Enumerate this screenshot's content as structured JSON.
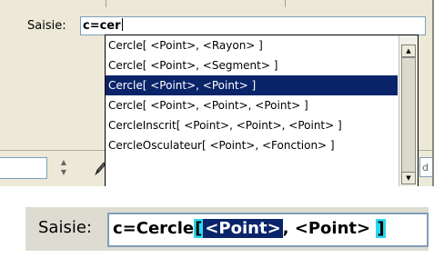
{
  "input": {
    "label": "Saisie:",
    "value": "c=cer"
  },
  "suggestions": {
    "items": [
      "Cercle[ <Point>, <Rayon> ]",
      "Cercle[ <Point>, <Segment> ]",
      "Cercle[ <Point>, <Point> ]",
      "Cercle[ <Point>, <Point>, <Point> ]",
      "CercleInscrit[ <Point>, <Point>, <Point> ]",
      "CercleOsculateur[ <Point>, <Fonction> ]"
    ],
    "selected_index": 2
  },
  "background": {
    "right_edge_text": "d"
  },
  "zoom": {
    "label": "Saisie:",
    "value_prefix": "c=Cercle",
    "open_bracket": "[",
    "active_param": "<Point>",
    "separator": ", ",
    "next_param": "<Point>",
    "space": " ",
    "close_bracket": "]"
  },
  "colors": {
    "selection": "#0a246a",
    "bracket_highlight": "#2bd7ef",
    "panel": "#ece9d8"
  }
}
